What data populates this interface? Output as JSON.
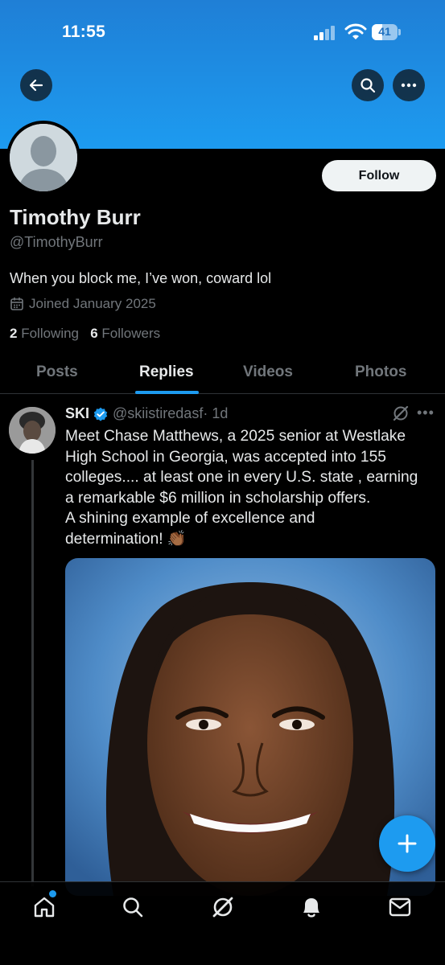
{
  "status_bar": {
    "time": "11:55",
    "battery": "41",
    "battery_level": 0.41
  },
  "header": {
    "back_icon": "arrow-left-icon",
    "search_icon": "search-icon",
    "more_icon": "more-horizontal-icon"
  },
  "profile": {
    "name": "Timothy Burr",
    "handle": "@TimothyBurr",
    "bio": "When you block me, I’ve won, coward lol",
    "joined": "Joined January 2025",
    "following_count": "2",
    "following_label": "Following",
    "followers_count": "6",
    "followers_label": "Followers",
    "follow_label": "Follow"
  },
  "tabs": [
    "Posts",
    "Replies",
    "Videos",
    "Photos"
  ],
  "active_tab": "Replies",
  "post": {
    "author_name": "SKI",
    "handle": "@skiistiredasf",
    "time": "· 1d",
    "body_lines": [
      "Meet Chase Matthews, a 2025 senior at Westlake",
      "High School in Georgia, was accepted into 155",
      "colleges.... at least one in every U.S. state , earning",
      "a remarkable $6 million in scholarship offers.",
      "A shining example of excellence and",
      "determination! 👏🏾"
    ]
  },
  "bottom_nav": [
    "home-icon",
    "search-icon",
    "grok-icon",
    "notifications-icon",
    "messages-icon"
  ],
  "colors": {
    "accent": "#1d9bf0",
    "background": "#000000",
    "muted": "#71767b",
    "text": "#e7e9ea"
  }
}
